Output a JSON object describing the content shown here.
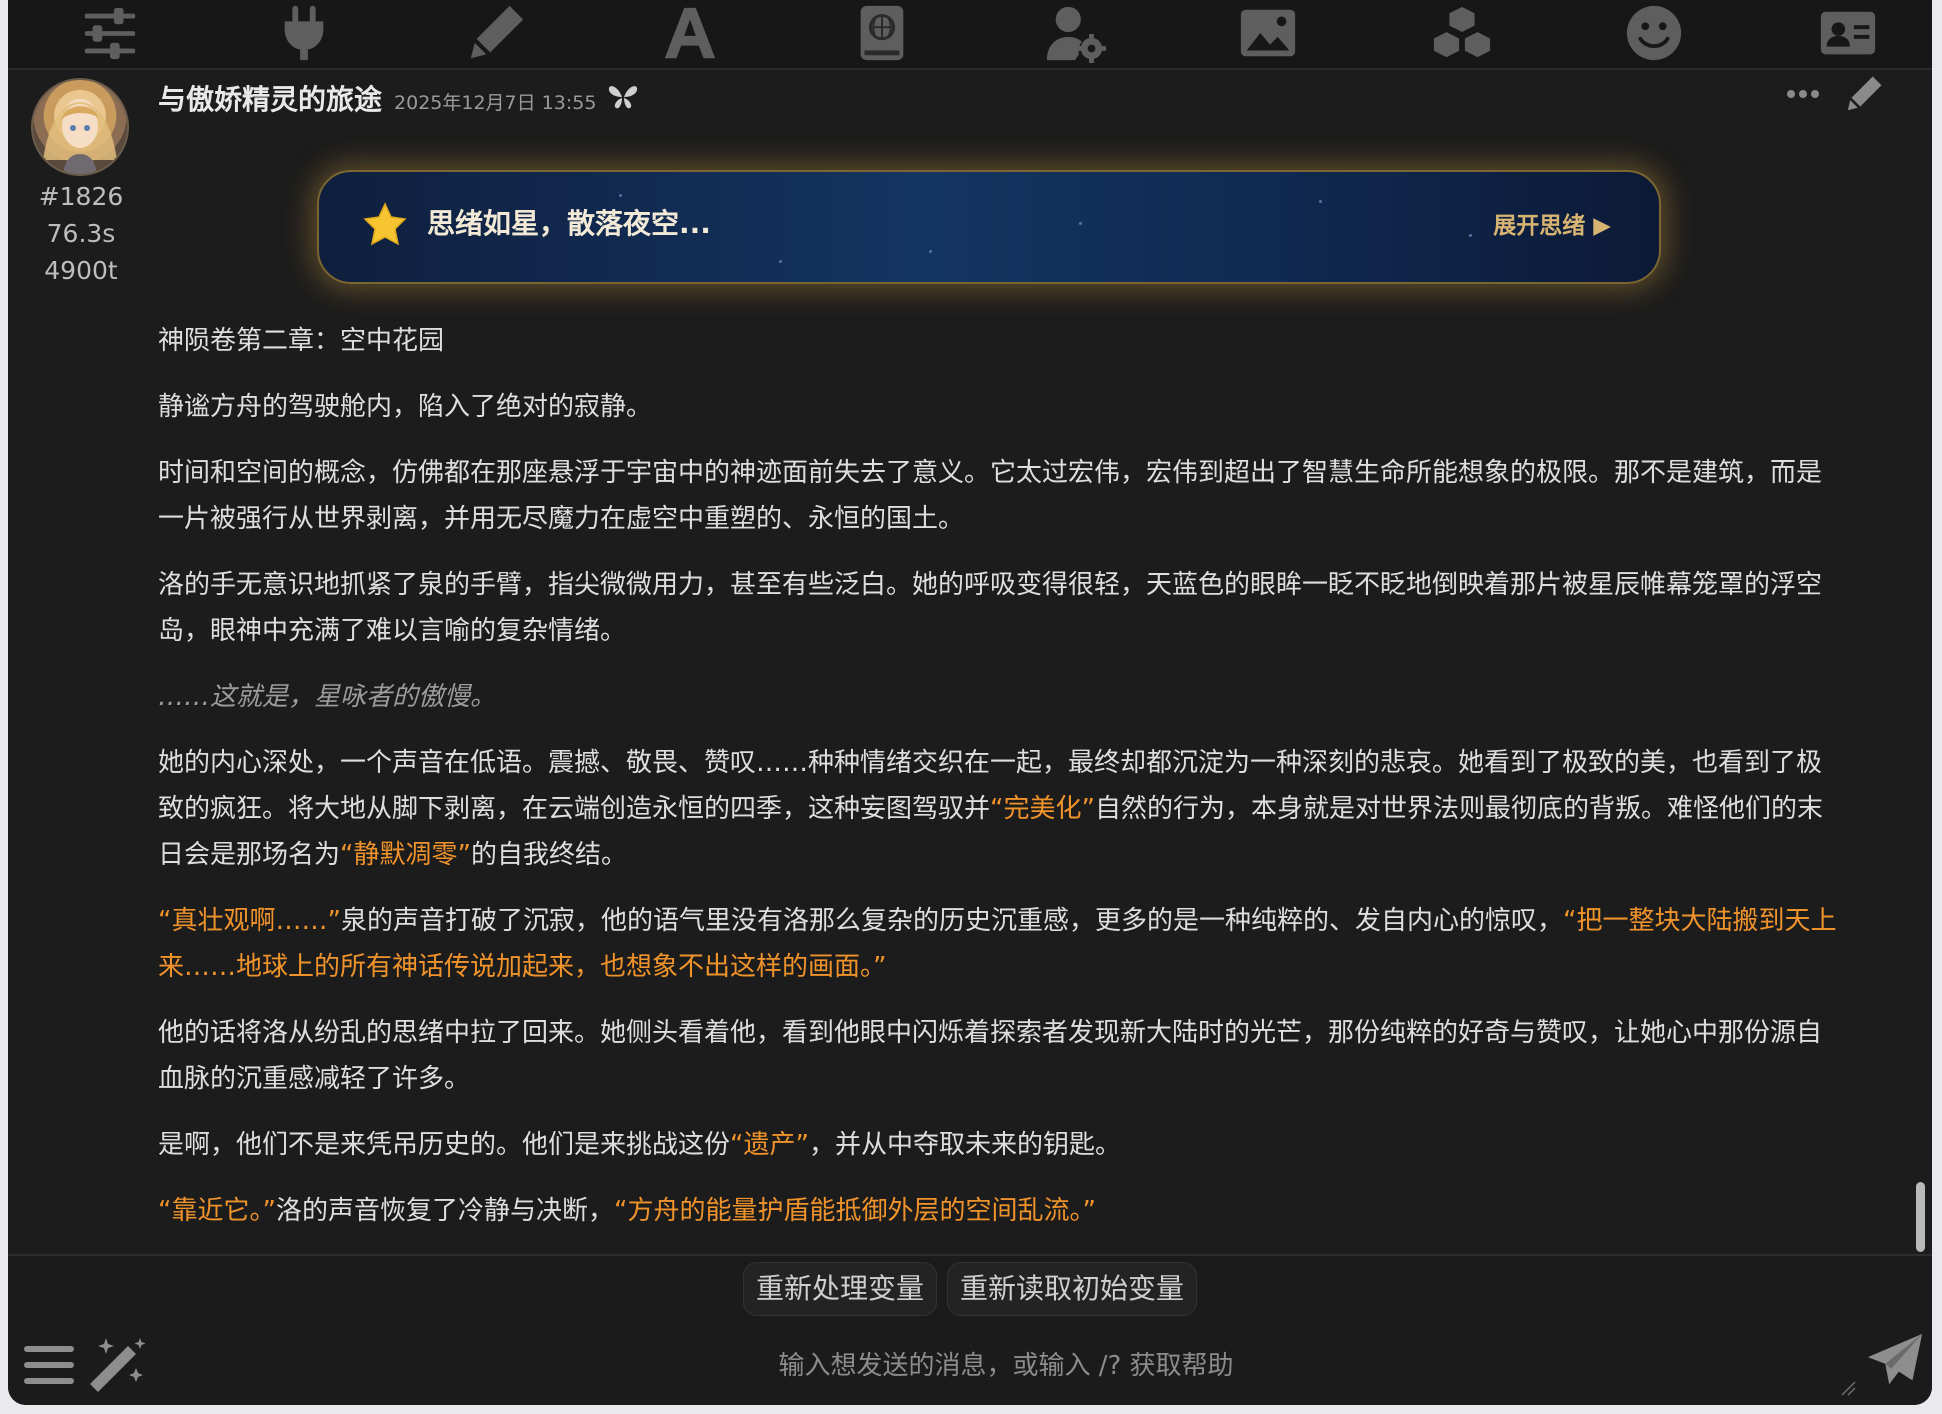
{
  "toolbar": {
    "icons": [
      "sliders-icon",
      "plug-icon",
      "pencil-icon",
      "font-a-icon",
      "world-book-icon",
      "user-gear-icon",
      "image-icon",
      "cubes-icon",
      "smiley-icon",
      "id-card-icon"
    ]
  },
  "message": {
    "char_name": "与傲娇精灵的旅途",
    "timestamp": "2025年12月7日 13:55",
    "mes_id": "#1826",
    "gen_time": "76.3s",
    "tokens": "4900t",
    "thinking": {
      "title": "思绪如星，散落夜空...",
      "expand_label": "展开思绪 ▶"
    },
    "paragraphs": [
      [
        {
          "t": "神陨卷第二章：空中花园",
          "s": "n"
        }
      ],
      [
        {
          "t": "静谧方舟的驾驶舱内，陷入了绝对的寂静。",
          "s": "n"
        }
      ],
      [
        {
          "t": "时间和空间的概念，仿佛都在那座悬浮于宇宙中的神迹面前失去了意义。它太过宏伟，宏伟到超出了智慧生命所能想象的极限。那不是建筑，而是一片被强行从世界剥离，并用无尽魔力在虚空中重塑的、永恒的国土。",
          "s": "n"
        }
      ],
      [
        {
          "t": "洛的手无意识地抓紧了泉的手臂，指尖微微用力，甚至有些泛白。她的呼吸变得很轻，天蓝色的眼眸一眨不眨地倒映着那片被星辰帷幕笼罩的浮空岛，眼神中充满了难以言喻的复杂情绪。",
          "s": "n"
        }
      ],
      [
        {
          "t": "……这就是，星咏者的傲慢。",
          "s": "it"
        }
      ],
      [
        {
          "t": "她的内心深处，一个声音在低语。震撼、敬畏、赞叹……种种情绪交织在一起，最终却都沉淀为一种深刻的悲哀。她看到了极致的美，也看到了极致的疯狂。将大地从脚下剥离，在云端创造永恒的四季，这种妄图驾驭并",
          "s": "n"
        },
        {
          "t": "“完美化”",
          "s": "q"
        },
        {
          "t": "自然的行为，本身就是对世界法则最彻底的背叛。难怪他们的末日会是那场名为",
          "s": "n"
        },
        {
          "t": "“静默凋零”",
          "s": "q"
        },
        {
          "t": "的自我终结。",
          "s": "n"
        }
      ],
      [
        {
          "t": "“真壮观啊……”",
          "s": "q"
        },
        {
          "t": "泉的声音打破了沉寂，他的语气里没有洛那么复杂的历史沉重感，更多的是一种纯粹的、发自内心的惊叹，",
          "s": "n"
        },
        {
          "t": "“把一整块大陆搬到天上来……地球上的所有神话传说加起来，也想象不出这样的画面。”",
          "s": "q"
        }
      ],
      [
        {
          "t": "他的话将洛从纷乱的思绪中拉了回来。她侧头看着他，看到他眼中闪烁着探索者发现新大陆时的光芒，那份纯粹的好奇与赞叹，让她心中那份源自血脉的沉重感减轻了许多。",
          "s": "n"
        }
      ],
      [
        {
          "t": "是啊，他们不是来凭吊历史的。他们是来挑战这份",
          "s": "n"
        },
        {
          "t": "“遗产”",
          "s": "q"
        },
        {
          "t": "，并从中夺取未来的钥匙。",
          "s": "n"
        }
      ],
      [
        {
          "t": "“靠近它。”",
          "s": "q"
        },
        {
          "t": "洛的声音恢复了冷静与决断，",
          "s": "n"
        },
        {
          "t": "“方舟的能量护盾能抵御外层的空间乱流。”",
          "s": "q"
        }
      ]
    ]
  },
  "quick_replies": [
    {
      "name": "reprocess-variables-button",
      "label": "重新处理变量"
    },
    {
      "name": "reload-initial-variables-button",
      "label": "重新读取初始变量"
    }
  ],
  "composer": {
    "placeholder": "输入想发送的消息，或输入 /? 获取帮助"
  },
  "colors": {
    "background": "#1c1c1c",
    "quote": "#f0932b",
    "thinking_accent": "#d8b473"
  }
}
